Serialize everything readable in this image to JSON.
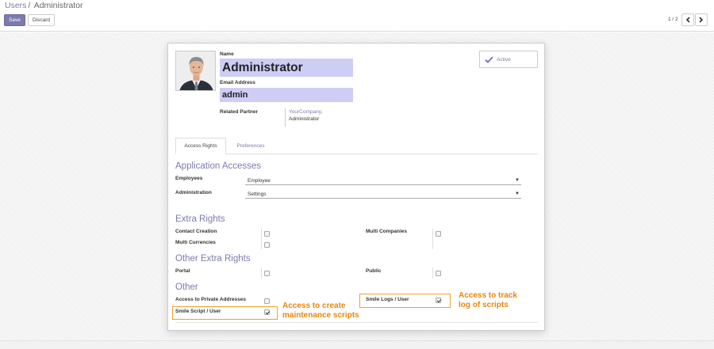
{
  "breadcrumb": {
    "parent": "Users",
    "separator": "/",
    "current": "Administrator"
  },
  "toolbar": {
    "save_label": "Save",
    "discard_label": "Discard"
  },
  "pager": {
    "value": "1 / 2",
    "prev_icon": "chevron-left-icon",
    "next_icon": "chevron-right-icon"
  },
  "form": {
    "name_label": "Name",
    "name_value": "Administrator",
    "email_label": "Email Address",
    "email_value": "admin",
    "partner_label": "Related Partner",
    "partner_link": "YourCompany,",
    "partner_sub": "Administrator",
    "active_label": "Active"
  },
  "tabs": [
    {
      "label": "Access Rights",
      "active": true
    },
    {
      "label": "Preferences",
      "active": false
    }
  ],
  "app_accesses": {
    "title": "Application Accesses",
    "employees_label": "Employees",
    "employees_value": "Employee",
    "administration_label": "Administration",
    "administration_value": "Settings",
    "dropdown_arrow": "▼"
  },
  "extra_rights": {
    "title": "Extra Rights",
    "contact_creation": {
      "label": "Contact Creation",
      "checked": false
    },
    "multi_companies": {
      "label": "Multi Companies",
      "checked": false
    },
    "multi_currencies": {
      "label": "Multi Currencies",
      "checked": false
    }
  },
  "other_extra_rights": {
    "title": "Other Extra Rights",
    "portal": {
      "label": "Portal",
      "checked": false
    },
    "public": {
      "label": "Public",
      "checked": false
    }
  },
  "other": {
    "title": "Other",
    "private_addresses": {
      "label": "Access to Private Addresses",
      "checked": false
    },
    "smile_script": {
      "label": "Smile Script / User",
      "checked": true
    },
    "smile_logs": {
      "label": "Smile Logs / User",
      "checked": true
    }
  },
  "annotations": {
    "script_note": "Access to create\nmaintenance scripts",
    "logs_note": "Access to track\nlog of scripts"
  },
  "colors": {
    "accent": "#7c7bad",
    "highlight": "#cdcdf6",
    "annotation": "#e8850c"
  }
}
